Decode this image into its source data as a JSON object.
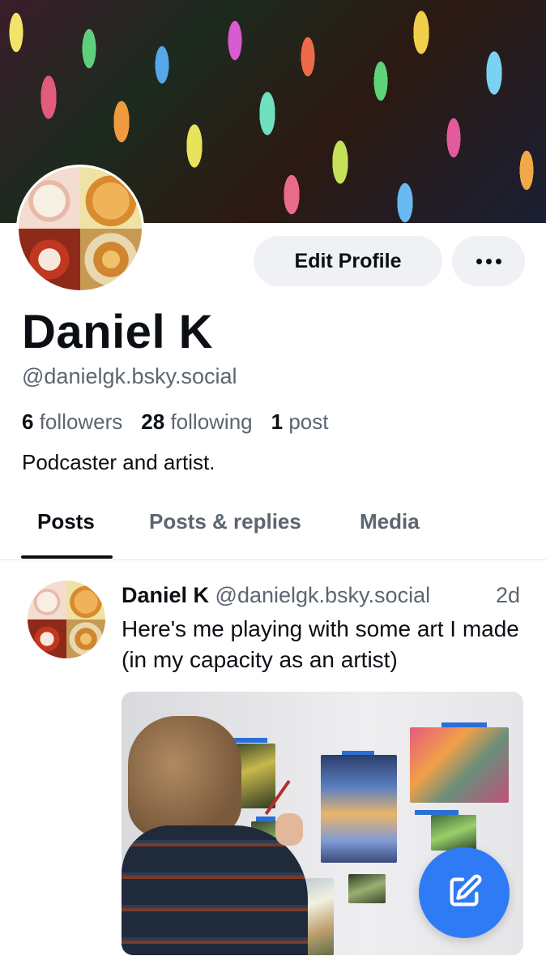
{
  "profile": {
    "display_name": "Daniel K",
    "handle": "@danielgk.bsky.social",
    "followers_count": "6",
    "followers_label": "followers",
    "following_count": "28",
    "following_label": "following",
    "posts_count": "1",
    "posts_label": "post",
    "bio": "Podcaster and artist."
  },
  "actions": {
    "edit_profile_label": "Edit Profile",
    "more_icon": "more-horizontal-icon"
  },
  "tabs": [
    {
      "label": "Posts",
      "active": true
    },
    {
      "label": "Posts & replies",
      "active": false
    },
    {
      "label": "Media",
      "active": false
    }
  ],
  "post": {
    "author": "Daniel K",
    "handle": "@danielgk.bsky.social",
    "time": "2d",
    "text": "Here's me playing with some art I made (in my capacity as an artist)"
  },
  "fab": {
    "icon": "compose-icon",
    "color": "#2f7bf6"
  }
}
